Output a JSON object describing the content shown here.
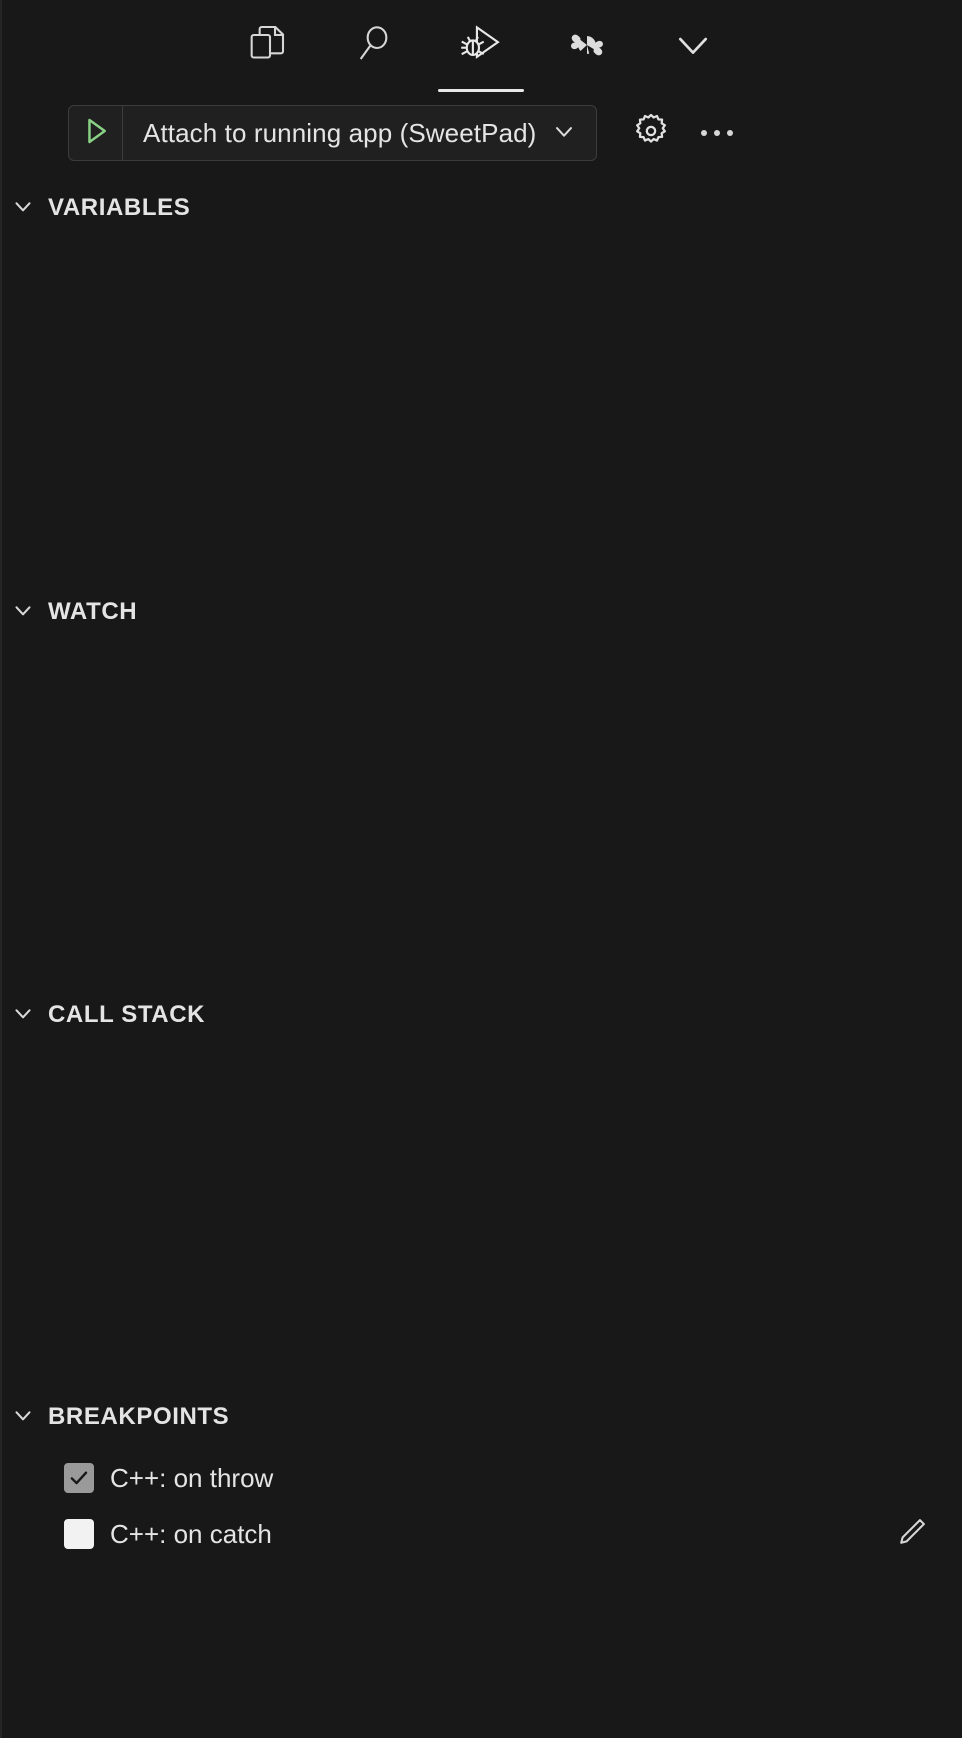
{
  "theme": {
    "background": "#181818",
    "foreground": "#e4e4e4",
    "accent_green": "#89d185",
    "border": "#3c3c3c",
    "checkbox_checked_bg": "#9a9a9a",
    "checkbox_unchecked_bg": "#f2f2f2",
    "active_tab_underline": "#e7e7e7"
  },
  "icon_tabs": [
    {
      "name": "explorer-icon",
      "title": "Explorer",
      "active": false
    },
    {
      "name": "search-icon",
      "title": "Search",
      "active": false
    },
    {
      "name": "run-debug-icon",
      "title": "Run and Debug",
      "active": true
    },
    {
      "name": "sweetpad-icon",
      "title": "SweetPad",
      "active": false
    },
    {
      "name": "chevron-down-icon",
      "title": "More",
      "active": false
    }
  ],
  "debug_toolbar": {
    "start_icon": "play-icon",
    "configuration": "Attach to running app (SweetPad)",
    "configuration_dropdown_icon": "chevron-down-icon",
    "gear_icon": "gear-icon",
    "more_icon": "more-ellipsis-icon"
  },
  "sections": [
    {
      "id": "variables",
      "title": "VARIABLES",
      "expanded": true,
      "items": []
    },
    {
      "id": "watch",
      "title": "WATCH",
      "expanded": true,
      "items": []
    },
    {
      "id": "callstack",
      "title": "CALL STACK",
      "expanded": true,
      "items": []
    },
    {
      "id": "breakpoints",
      "title": "BREAKPOINTS",
      "expanded": true
    }
  ],
  "breakpoints": {
    "title": "BREAKPOINTS",
    "edit_icon": "pencil-icon",
    "items": [
      {
        "label": "C++: on throw",
        "checked": true
      },
      {
        "label": "C++: on catch",
        "checked": false
      }
    ]
  }
}
